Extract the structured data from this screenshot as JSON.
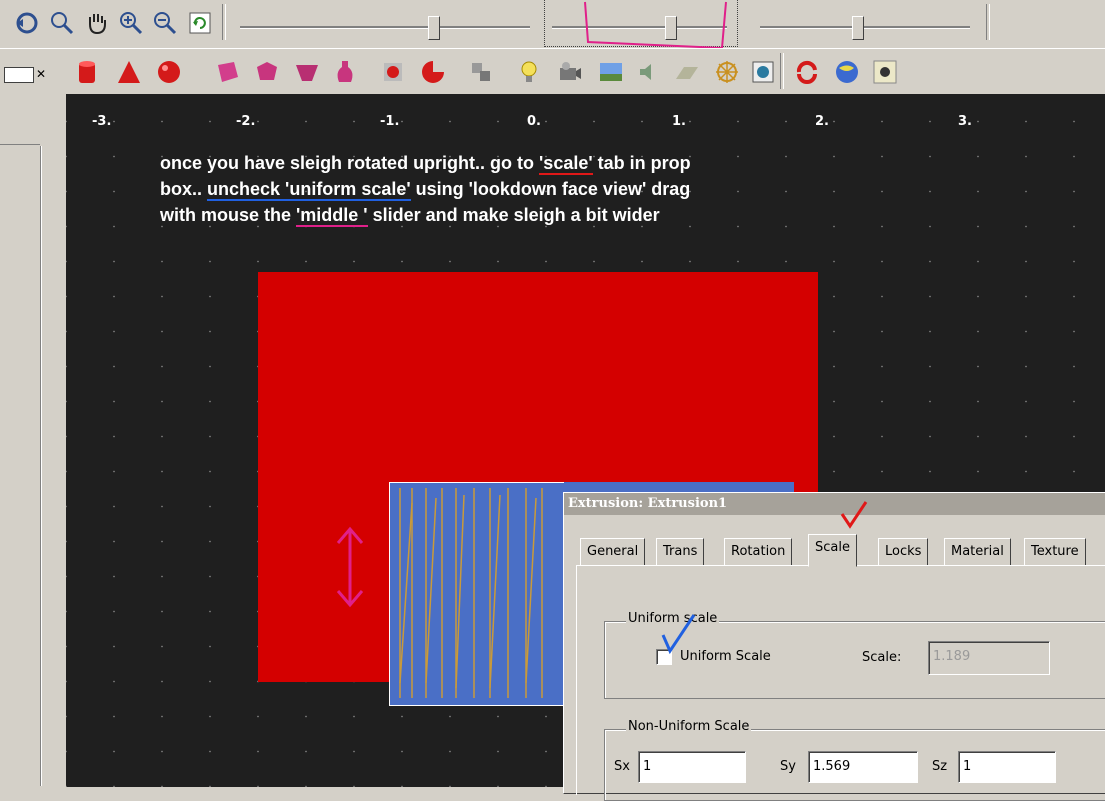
{
  "toolbar_top": {
    "icons": [
      "orbit-icon",
      "zoom-region-icon",
      "pan-hand-icon",
      "zoom-in-icon",
      "zoom-out-icon",
      "rotate-view-icon"
    ]
  },
  "toolbar_shapes": {
    "icons": [
      "cylinder-icon",
      "cone-icon",
      "sphere-icon",
      "polyhedron-icon",
      "gem-icon",
      "faceted-icon",
      "vase-icon",
      "gear-cube-icon",
      "sphere-cut-icon",
      "cube-group-icon",
      "light-bulb-icon",
      "camera-icon",
      "background-icon",
      "sound-icon",
      "ground-plane-icon",
      "navigation-wheel-icon",
      "viewpoint-icon",
      "rotate-arrows-icon",
      "globe-icon",
      "bug-icon"
    ]
  },
  "viewport": {
    "ticks": [
      "-3.",
      "-2.",
      "-1.",
      "0.",
      "1.",
      "2.",
      "3."
    ],
    "instructions": {
      "l1a": "once you have sleigh rotated upright.. go to ",
      "l1b": "'scale'",
      "l1c": " tab in prop",
      "l2a": "box.. ",
      "l2b": "uncheck 'uniform scale'",
      "l2c": " using 'lookdown face view' drag",
      "l3a": "with mouse the ",
      "l3b": "'middle '",
      "l3c": " slider and make sleigh a bit wider"
    },
    "colors": {
      "red_box": "#d40000",
      "blue_object": "#4a6fc6",
      "annotation_pink": "#e0208a",
      "annotation_red": "#e01818",
      "annotation_blue": "#2060e0"
    }
  },
  "dialog": {
    "title": "Extrusion: Extrusion1",
    "tabs": [
      "General",
      "Trans",
      "Rotation",
      "Scale",
      "Locks",
      "Material",
      "Texture"
    ],
    "active_tab": "Scale",
    "uniform_group": "Uniform scale",
    "uniform_checkbox_label": "Uniform Scale",
    "uniform_checked": false,
    "scale_label": "Scale:",
    "scale_value": "1.189",
    "nonuniform_group": "Non-Uniform Scale",
    "sx_label": "Sx",
    "sx_value": "1",
    "sy_label": "Sy",
    "sy_value": "1.569",
    "sz_label": "Sz",
    "sz_value": "1"
  }
}
